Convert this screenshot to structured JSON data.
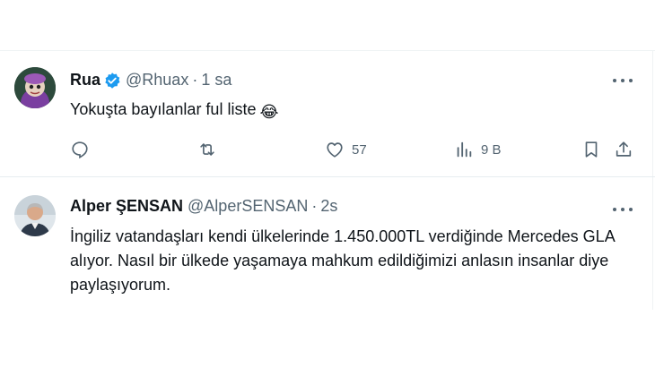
{
  "tweets": [
    {
      "name": "Rua",
      "handle": "@Rhuax",
      "time": "1 sa",
      "text": "Yokuşta bayılanlar ful liste",
      "emoji": "😂",
      "verified": true,
      "actions": {
        "reply": "",
        "retweet": "",
        "like": "57",
        "views": "9 B"
      }
    },
    {
      "name": "Alper ŞENSAN",
      "handle": "@AlperSENSAN",
      "time": "2s",
      "text": "İngiliz vatandaşları kendi ülkelerinde 1.450.000TL verdiğinde Mercedes GLA alıyor. Nasıl bir ülkede yaşamaya mahkum edildiğimizi anlasın insanlar diye paylaşıyorum."
    }
  ],
  "colors": {
    "text": "#0f1419",
    "secondary": "#536471",
    "verified": "#1d9bf0",
    "divider": "#eff3f4"
  },
  "icons": [
    "reply-icon",
    "retweet-icon",
    "like-icon",
    "views-icon",
    "bookmark-icon",
    "share-icon",
    "more-icon",
    "verified-badge-icon"
  ]
}
